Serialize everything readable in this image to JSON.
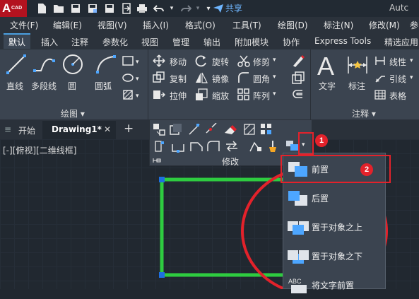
{
  "app": {
    "logo_main": "A",
    "logo_sub": "CAD",
    "title": "Autc",
    "share_label": "共享"
  },
  "menubar": [
    {
      "label": "文件(F)"
    },
    {
      "label": "编辑(E)"
    },
    {
      "label": "视图(V)"
    },
    {
      "label": "插入(I)"
    },
    {
      "label": "格式(O)"
    },
    {
      "label": "工具(T)"
    },
    {
      "label": "绘图(D)"
    },
    {
      "label": "标注(N)"
    },
    {
      "label": "修改(M)"
    },
    {
      "label": "参"
    }
  ],
  "ribbon_tabs": [
    {
      "label": "默认"
    },
    {
      "label": "插入"
    },
    {
      "label": "注释"
    },
    {
      "label": "参数化"
    },
    {
      "label": "视图"
    },
    {
      "label": "管理"
    },
    {
      "label": "输出"
    },
    {
      "label": "附加模块"
    },
    {
      "label": "协作"
    },
    {
      "label": "Express Tools"
    },
    {
      "label": "精选应用"
    }
  ],
  "draw_panel": {
    "title": "绘图 ▾",
    "tools": [
      {
        "label": "直线"
      },
      {
        "label": "多段线"
      },
      {
        "label": "圆"
      },
      {
        "label": "圆弧"
      }
    ]
  },
  "modify_panel": {
    "title": "修改",
    "tools": [
      {
        "label": "移动"
      },
      {
        "label": "旋转"
      },
      {
        "label": "修剪"
      },
      {
        "label": "复制"
      },
      {
        "label": "镜像"
      },
      {
        "label": "圆角"
      },
      {
        "label": "拉伸"
      },
      {
        "label": "缩放"
      },
      {
        "label": "阵列"
      }
    ]
  },
  "annotation_panel": {
    "title": "注释 ▾",
    "tools": [
      {
        "label": "文字"
      },
      {
        "label": "标注"
      },
      {
        "label": "线性"
      },
      {
        "label": "引线"
      },
      {
        "label": "表格"
      }
    ]
  },
  "file_tabs": {
    "start": "开始",
    "drawing": "Drawing1*",
    "close": "✕",
    "add": "+"
  },
  "viewport": {
    "label": "[-][俯视][二维线框]"
  },
  "draw_order_menu": [
    {
      "label": "前置"
    },
    {
      "label": "后置"
    },
    {
      "label": "置于对象之上"
    },
    {
      "label": "置于对象之下"
    },
    {
      "label": "将文字前置"
    }
  ],
  "annotations": {
    "badge1": "1",
    "badge2": "2"
  },
  "colors": {
    "accent_red": "#e3222b",
    "green_rect": "#2ecc40",
    "grip_blue": "#1e6fe0"
  }
}
